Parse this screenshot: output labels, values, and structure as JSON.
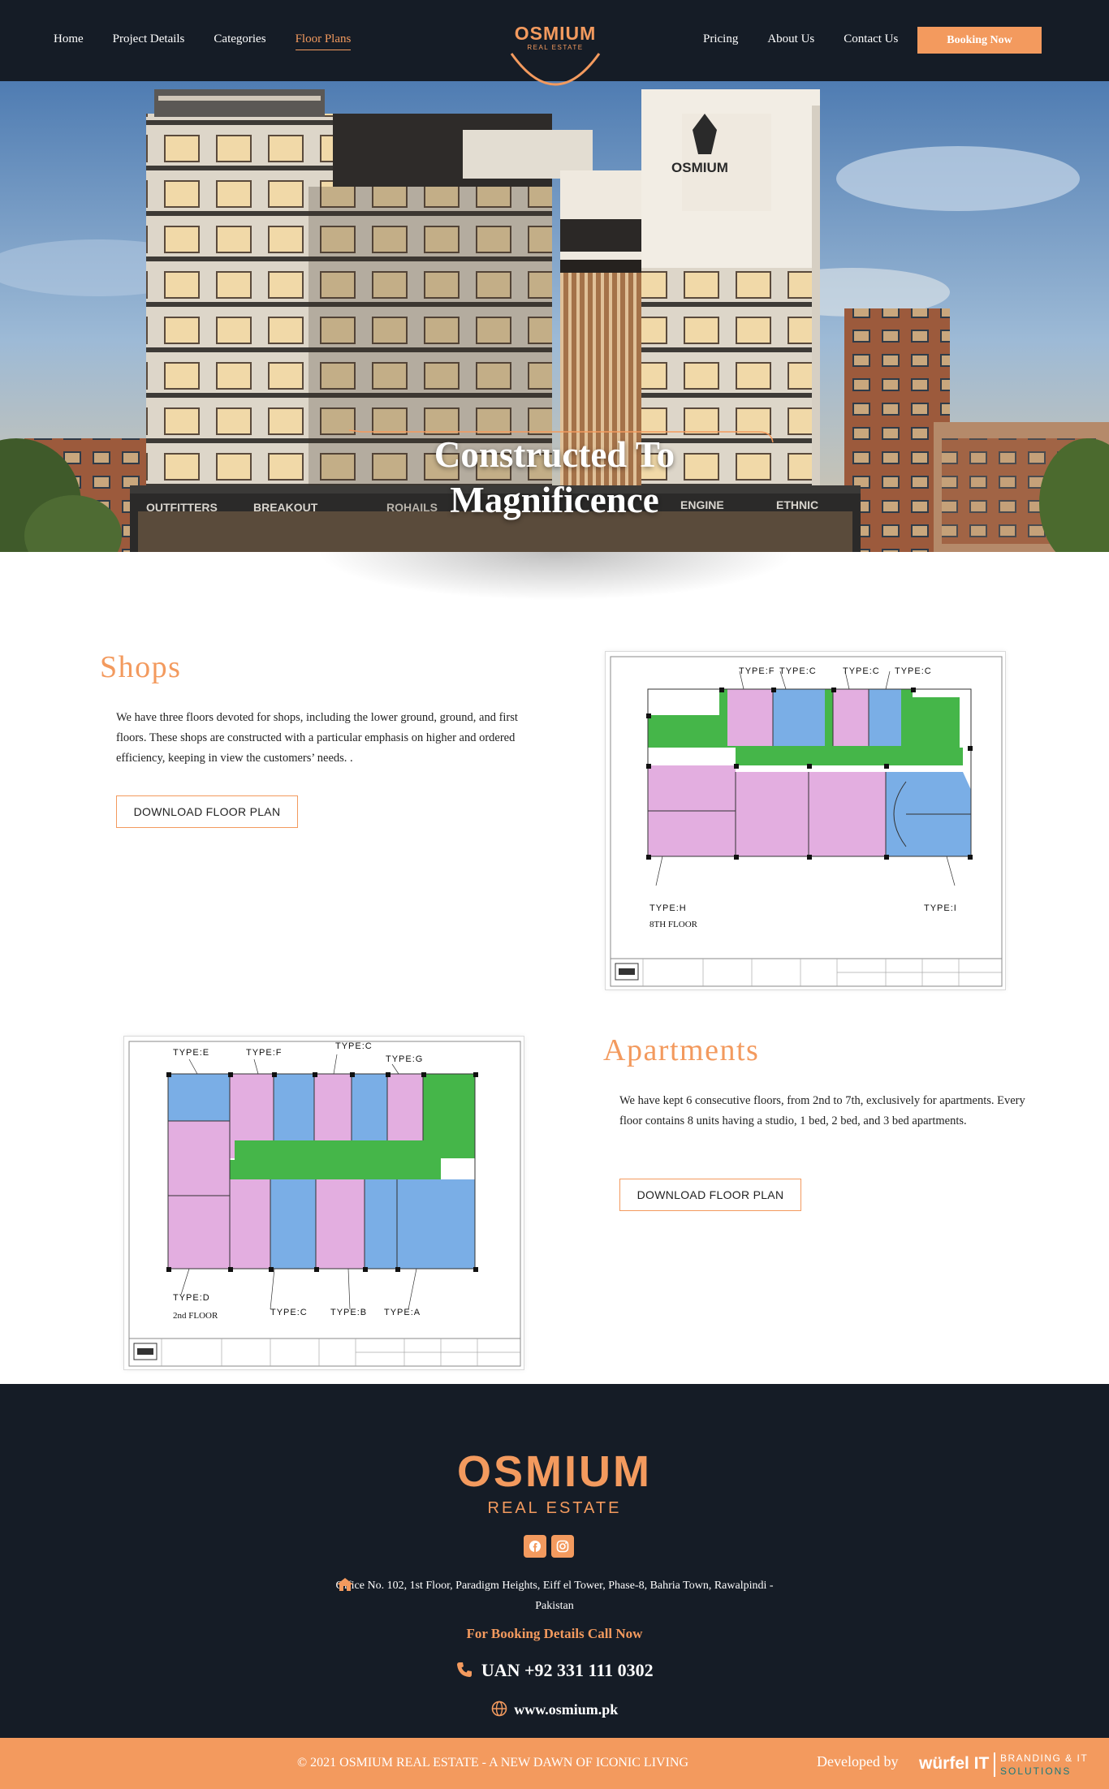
{
  "header": {
    "nav_left": [
      {
        "label": "Home"
      },
      {
        "label": "Project Details"
      },
      {
        "label": "Categories"
      },
      {
        "label": "Floor Plans",
        "active": true
      }
    ],
    "logo_word": "OSMIUM",
    "logo_sub": "REAL ESTATE",
    "nav_right": [
      {
        "label": "Pricing"
      },
      {
        "label": "About Us"
      },
      {
        "label": "Contact Us"
      }
    ],
    "booking_label": "Booking Now"
  },
  "hero": {
    "title_line1": "Constructed To",
    "title_line2": "Magnificence",
    "building_sign": "OSMIUM",
    "shop_signs": [
      "OUTFITTERS",
      "BREAKOUT",
      "ROHAILS",
      "ENGINE",
      "ETHNIC"
    ]
  },
  "shops": {
    "title": "Shops",
    "text": "We have three floors devoted for shops, including the lower ground, ground, and first floors. These shops are constructed with a particular emphasis on higher and ordered efficiency, keeping in view the customers’ needs. .",
    "button": "DOWNLOAD FLOOR PLAN",
    "plan_labels": [
      "TYPE:F",
      "TYPE:C",
      "TYPE:C",
      "TYPE:C",
      "TYPE:H",
      "TYPE:I"
    ],
    "plan_floor": "8TH FLOOR"
  },
  "apartments": {
    "title": "Apartments",
    "text": "We have kept 6 consecutive floors, from 2nd to 7th, exclusively for apartments. Every floor contains 8 units having a studio, 1 bed, 2 bed, and 3 bed apartments.",
    "button": "DOWNLOAD FLOOR PLAN",
    "plan_labels": [
      "TYPE:E",
      "TYPE:F",
      "TYPE:C",
      "TYPE:G",
      "TYPE:D",
      "TYPE:C",
      "TYPE:B",
      "TYPE:A"
    ],
    "plan_floor": "2nd FLOOR"
  },
  "footer": {
    "logo_word": "OSMIUM",
    "logo_sub": "REAL ESTATE",
    "address": "Office No. 102, 1st Floor, Paradigm Heights, Eiff el Tower, Phase-8, Bahria Town, Rawalpindi - Pakistan",
    "call_now": "For Booking Details Call Now",
    "phone": "UAN +92 331 111 0302",
    "website": "www.osmium.pk",
    "copyright": "© 2021 OSMIUM REAL ESTATE - A NEW DAWN OF ICONIC LIVING",
    "developed_by": "Developed by",
    "dev_name": "würfel IT",
    "dev_tag1": "BRANDING & IT",
    "dev_tag2": "SOLUTIONS"
  },
  "colors": {
    "accent": "#f39a5e",
    "dark": "#151c26",
    "plan_green": "#45b649",
    "plan_pink": "#e3aee0",
    "plan_blue": "#7aaee6"
  },
  "icons": [
    "home-icon",
    "phone-icon",
    "globe-icon",
    "facebook-icon",
    "instagram-icon"
  ]
}
